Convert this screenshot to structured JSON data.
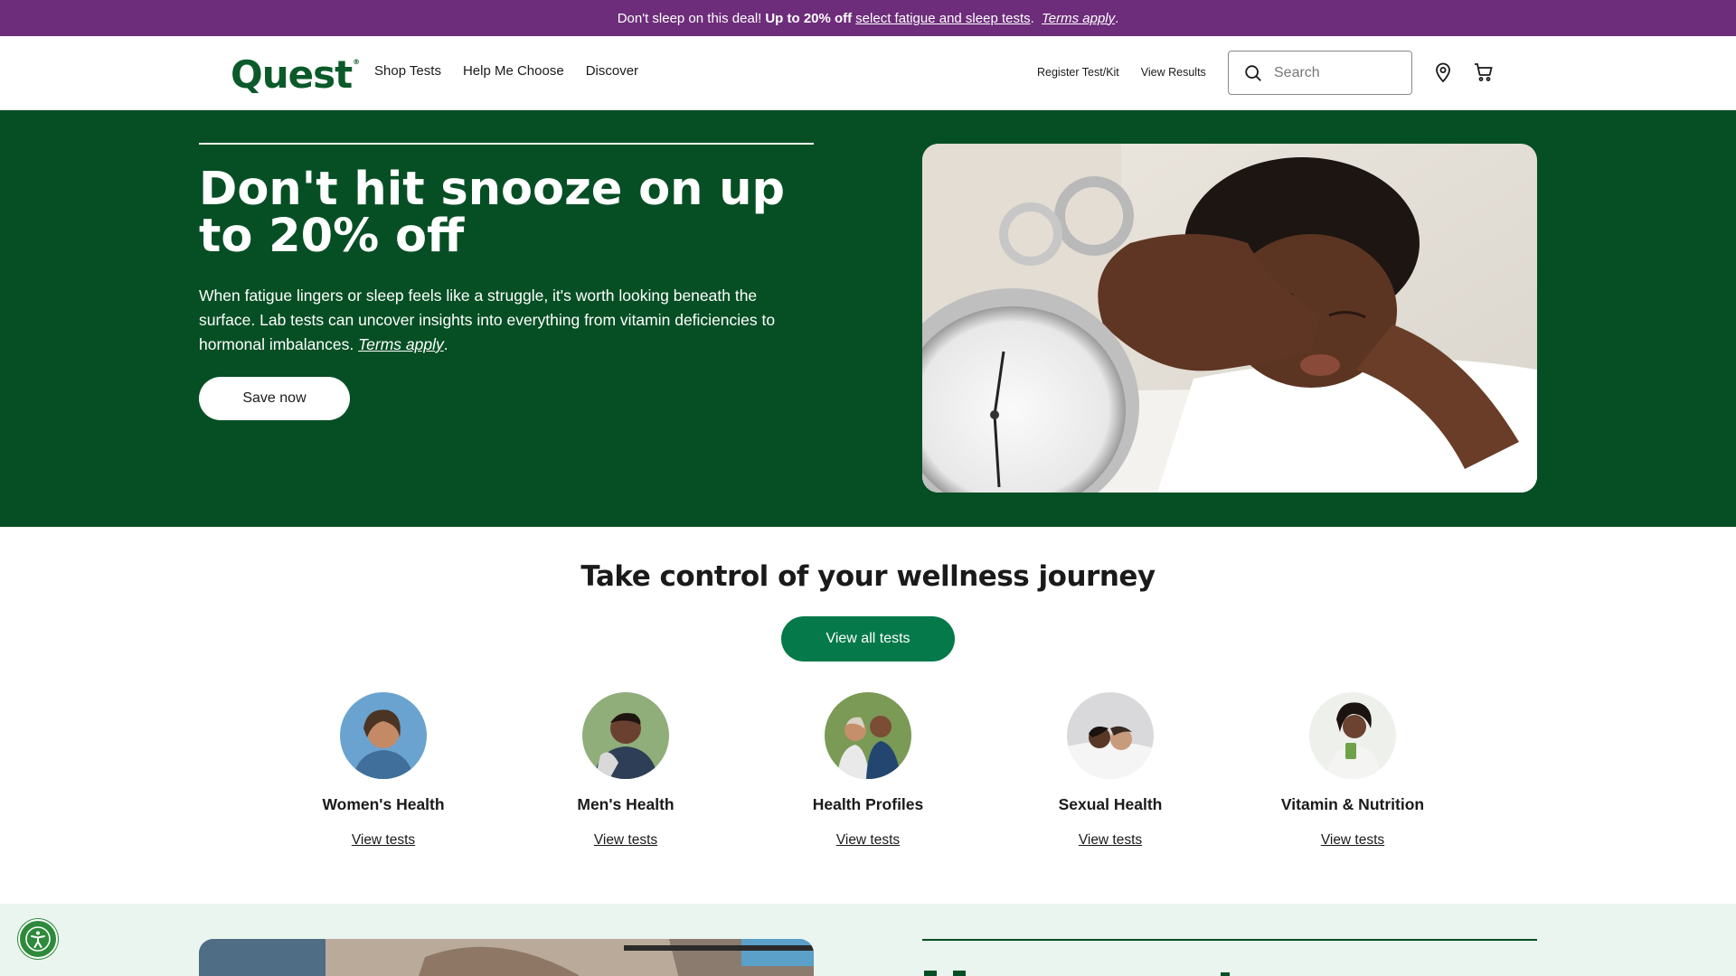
{
  "promo": {
    "lead": "Don't sleep on this deal!",
    "bold": "Up to 20% off",
    "link": "select fatigue and sleep tests",
    "dot": ".",
    "terms": "Terms apply",
    "end": "."
  },
  "header": {
    "logo": "Quest",
    "logo_mark": "®",
    "nav": [
      "Shop Tests",
      "Help Me Choose",
      "Discover"
    ],
    "util": [
      "Register Test/Kit",
      "View Results"
    ],
    "search_placeholder": "Search"
  },
  "hero": {
    "title": "Don't hit snooze on up to 20% off",
    "text": "When fatigue lingers or sleep feels like a struggle, it's worth looking beneath the surface. Lab tests can uncover insights into everything from vitamin deficiencies to hormonal imbalances.",
    "terms": "Terms apply",
    "terms_end": ".",
    "cta": "Save now"
  },
  "wellness": {
    "title": "Take control of your wellness journey",
    "cta": "View all tests",
    "categories": [
      {
        "name": "Women's Health",
        "link": "View tests"
      },
      {
        "name": "Men's Health",
        "link": "View tests"
      },
      {
        "name": "Health Profiles",
        "link": "View tests"
      },
      {
        "name": "Sexual Health",
        "link": "View tests"
      },
      {
        "name": "Vitamin & Nutrition",
        "link": "View tests"
      }
    ]
  },
  "colors": {
    "promo_bg": "#6d2d7a",
    "brand_green": "#0b5a2a",
    "hero_bg": "#064f24",
    "cta_green": "#05794a",
    "bottom_bg": "#e9f5ee"
  }
}
